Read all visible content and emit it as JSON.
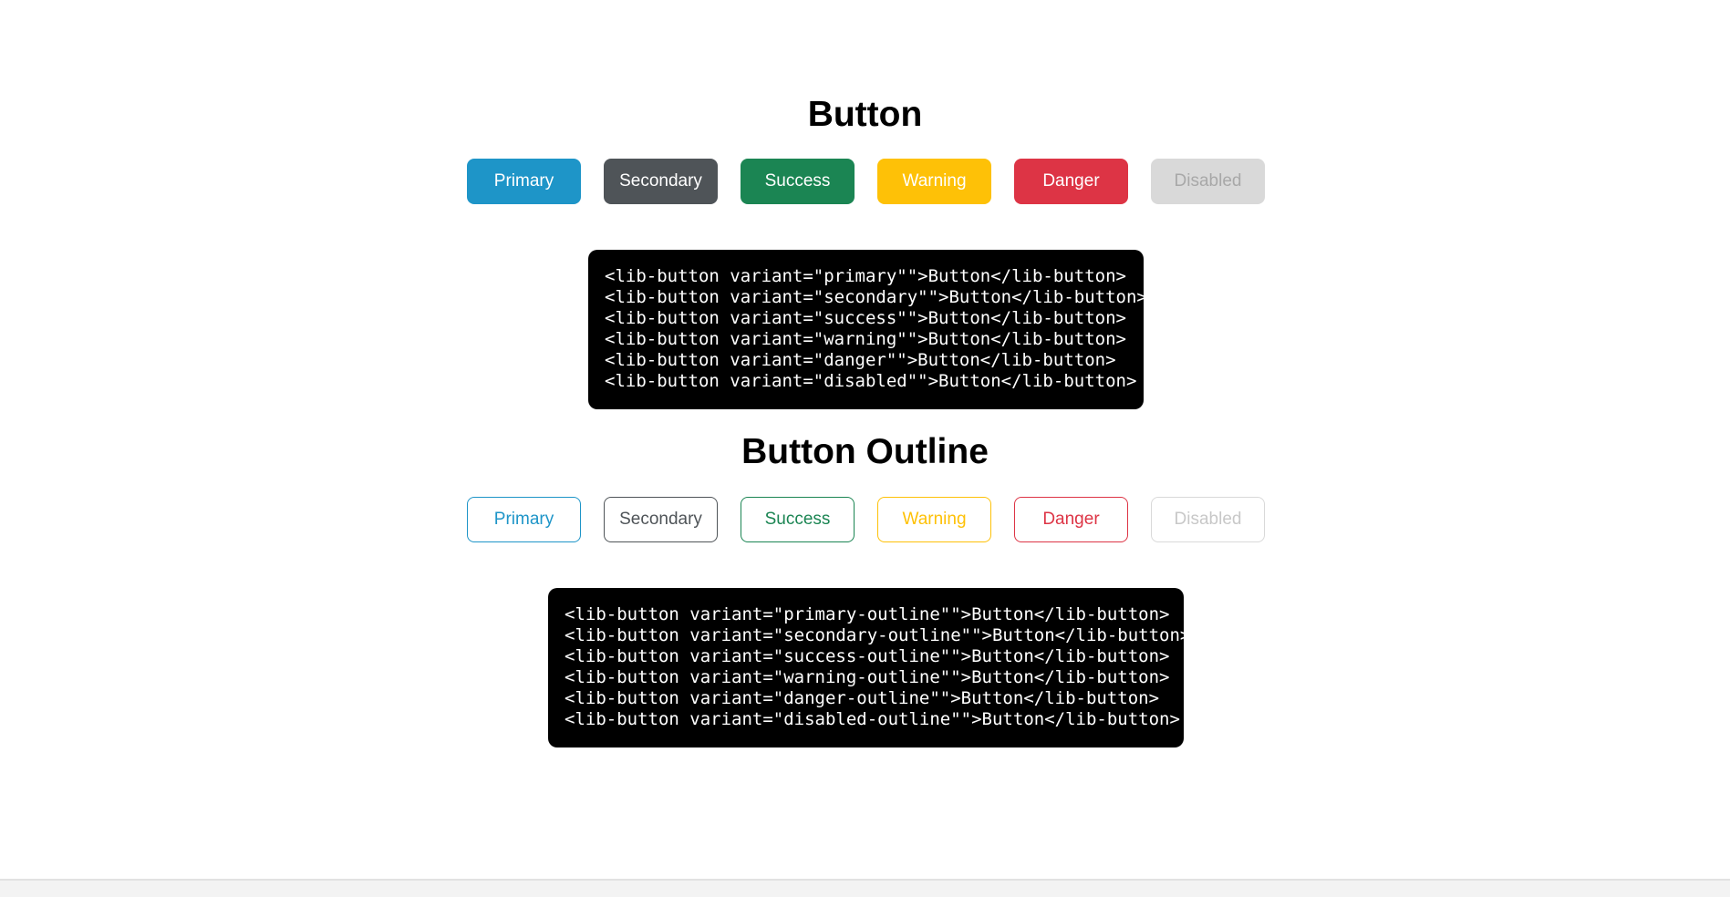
{
  "section1": {
    "title": "Button",
    "buttons": [
      {
        "label": "Primary",
        "variant": "primary"
      },
      {
        "label": "Secondary",
        "variant": "secondary"
      },
      {
        "label": "Success",
        "variant": "success"
      },
      {
        "label": "Warning",
        "variant": "warning"
      },
      {
        "label": "Danger",
        "variant": "danger"
      },
      {
        "label": "Disabled",
        "variant": "disabled"
      }
    ],
    "code_lines": [
      "<lib-button variant=\"primary\"\">Button</lib-button>",
      "<lib-button variant=\"secondary\"\">Button</lib-button>",
      "<lib-button variant=\"success\"\">Button</lib-button>",
      "<lib-button variant=\"warning\"\">Button</lib-button>",
      "<lib-button variant=\"danger\"\">Button</lib-button>",
      "<lib-button variant=\"disabled\"\">Button</lib-button>"
    ]
  },
  "section2": {
    "title": "Button Outline",
    "buttons": [
      {
        "label": "Primary",
        "variant": "primary-outline"
      },
      {
        "label": "Secondary",
        "variant": "secondary-outline"
      },
      {
        "label": "Success",
        "variant": "success-outline"
      },
      {
        "label": "Warning",
        "variant": "warning-outline"
      },
      {
        "label": "Danger",
        "variant": "danger-outline"
      },
      {
        "label": "Disabled",
        "variant": "disabled-outline"
      }
    ],
    "code_lines": [
      "<lib-button variant=\"primary-outline\"\">Button</lib-button>",
      "<lib-button variant=\"secondary-outline\"\">Button</lib-button>",
      "<lib-button variant=\"success-outline\"\">Button</lib-button>",
      "<lib-button variant=\"warning-outline\"\">Button</lib-button>",
      "<lib-button variant=\"danger-outline\"\">Button</lib-button>",
      "<lib-button variant=\"disabled-outline\"\">Button</lib-button>"
    ]
  },
  "colors": {
    "primary": "#1e95c8",
    "secondary": "#4f5458",
    "success": "#1b8553",
    "warning": "#fec107",
    "danger": "#dd3445",
    "disabled": "#d9d9d9"
  }
}
